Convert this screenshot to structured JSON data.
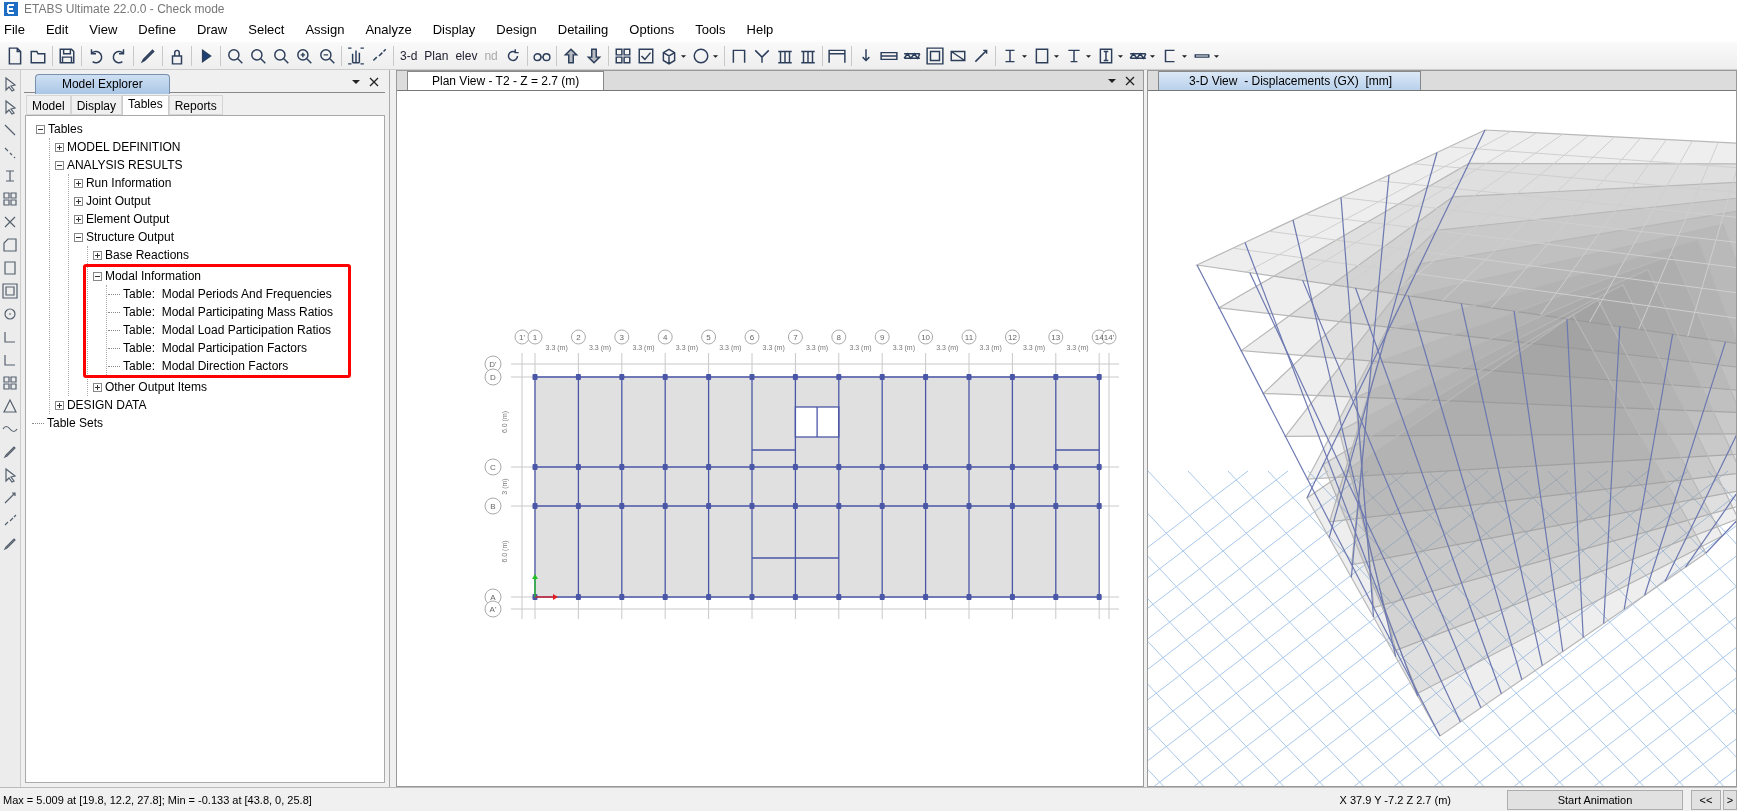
{
  "window": {
    "title": "ETABS Ultimate 22.0.0 - Check mode"
  },
  "menu": [
    "File",
    "Edit",
    "View",
    "Define",
    "Draw",
    "Select",
    "Assign",
    "Analyze",
    "Display",
    "Design",
    "Detailing",
    "Options",
    "Tools",
    "Help"
  ],
  "toolbar": {
    "text_buttons": [
      {
        "label": "3-d",
        "disabled": false
      },
      {
        "label": "Plan",
        "disabled": false
      },
      {
        "label": "elev",
        "disabled": false
      },
      {
        "label": "nd",
        "disabled": true
      }
    ]
  },
  "model_explorer": {
    "title": "Model Explorer",
    "tabs": [
      {
        "label": "Model",
        "selected": false
      },
      {
        "label": "Display",
        "selected": false
      },
      {
        "label": "Tables",
        "selected": true
      },
      {
        "label": "Reports",
        "selected": false
      }
    ],
    "tree": [
      {
        "label": "Tables",
        "expanded": true,
        "children": [
          {
            "label": "MODEL DEFINITION",
            "expanded": false
          },
          {
            "label": "ANALYSIS RESULTS",
            "expanded": true,
            "children": [
              {
                "label": "Run Information",
                "expanded": false
              },
              {
                "label": "Joint Output",
                "expanded": false
              },
              {
                "label": "Element Output",
                "expanded": false
              },
              {
                "label": "Structure Output",
                "expanded": true,
                "children": [
                  {
                    "label": "Base Reactions",
                    "expanded": false,
                    "highlighted": false
                  },
                  {
                    "label": "Modal Information",
                    "expanded": true,
                    "highlighted": true,
                    "children": [
                      {
                        "label": "Table:  Modal Periods And Frequencies"
                      },
                      {
                        "label": "Table:  Modal Participating Mass Ratios"
                      },
                      {
                        "label": "Table:  Modal Load Participation Ratios"
                      },
                      {
                        "label": "Table:  Modal Participation Factors"
                      },
                      {
                        "label": "Table:  Modal Direction Factors"
                      }
                    ]
                  },
                  {
                    "label": "Other Output Items",
                    "expanded": false,
                    "highlighted": false
                  }
                ]
              }
            ]
          },
          {
            "label": "DESIGN DATA",
            "expanded": false
          }
        ]
      },
      {
        "label": "Table Sets"
      }
    ]
  },
  "plan_view": {
    "title": "Plan View - T2 - Z = 2.7 (m)",
    "x_grid": [
      "1'",
      "1",
      "2",
      "3",
      "4",
      "5",
      "6",
      "7",
      "8",
      "9",
      "10",
      "11",
      "12",
      "13",
      "14",
      "14'"
    ],
    "y_grid": [
      "D'",
      "D",
      "C",
      "B",
      "A",
      "A'"
    ],
    "x_spacings": [
      "3.3 (m)",
      "3.3 (m)",
      "3.3 (m)",
      "3.3 (m)",
      "3.3 (m)",
      "3.3 (m)",
      "3.3 (m)",
      "3.3 (m)",
      "3.3 (m)",
      "3.3 (m)",
      "3.3 (m)",
      "3.3 (m)",
      "3.3 (m)"
    ],
    "y_spacings": [
      "6.0 (m)",
      "3 (m)",
      "6.0 (m)"
    ]
  },
  "view_3d": {
    "title": "3-D View  - Displacements (GX)  [mm]"
  },
  "status_bar": {
    "message": "Max = 5.009 at [19.8, 12.2, 27.8];  Min = -0.133 at [43.8, 0, 25.8]",
    "coordinates": "X 37.9  Y -7.2  Z 2.7 (m)",
    "buttons": [
      "Start Animation",
      "<<",
      ">"
    ]
  }
}
